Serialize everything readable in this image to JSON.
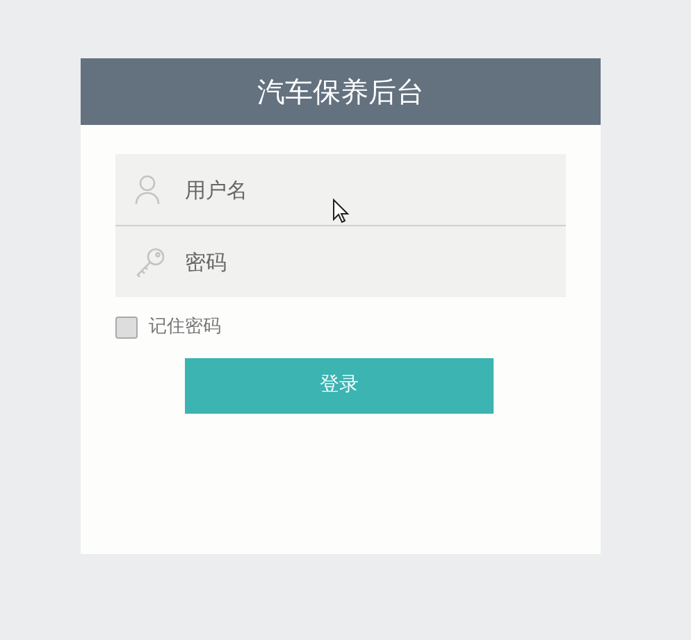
{
  "title": "汽车保养后台",
  "fields": [
    {
      "kind": "text",
      "placeholder": "用户名"
    },
    {
      "kind": "password",
      "placeholder": "密码"
    }
  ],
  "remember": {
    "label": "记住密码",
    "checked": false
  },
  "submit": {
    "label": "登录"
  }
}
